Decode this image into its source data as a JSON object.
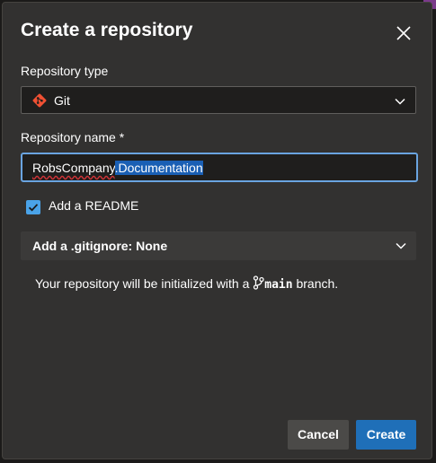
{
  "dialog": {
    "title": "Create a repository",
    "close_icon": "close-icon"
  },
  "repo_type": {
    "label": "Repository type",
    "value": "Git",
    "icon": "git-icon"
  },
  "repo_name": {
    "label": "Repository name *",
    "value_prefix": "RobsCompany",
    "value_selected": ".Documentation"
  },
  "readme": {
    "label": "Add a README",
    "checked": true
  },
  "gitignore": {
    "label": "Add a .gitignore: None"
  },
  "info": {
    "prefix": "Your repository will be initialized with a ",
    "branch": "main",
    "suffix": " branch."
  },
  "buttons": {
    "cancel": "Cancel",
    "create": "Create"
  },
  "colors": {
    "dialog_bg": "#323130",
    "accent": "#1f6fb8",
    "focus_border": "#6aa4e0",
    "git_icon": "#f05033"
  }
}
